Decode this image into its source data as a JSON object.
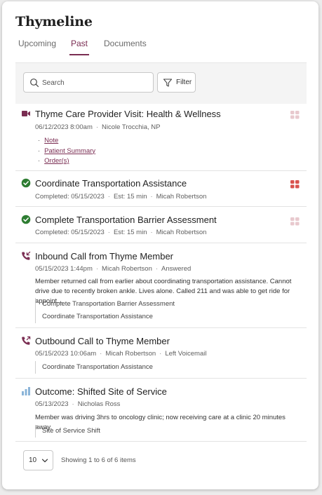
{
  "app": {
    "logo": "Thymeline"
  },
  "tabs": [
    {
      "label": "Upcoming",
      "active": false
    },
    {
      "label": "Past",
      "active": true
    },
    {
      "label": "Documents",
      "active": false
    }
  ],
  "toolbar": {
    "search_placeholder": "Search",
    "filter_label": "Filter"
  },
  "colors": {
    "accent": "#7a2d52",
    "success": "#2e7d32",
    "corner_active": "#d9534f",
    "corner_inactive": "#e8c9ce",
    "chart_icon": "#8ab4d8"
  },
  "items": [
    {
      "icon": "video-icon",
      "title": "Thyme Care Provider Visit: Health & Wellness",
      "date": "06/12/2023 8:00am",
      "person": "Nicole Trocchia, NP",
      "links": [
        "Note",
        "Patient Summary",
        "Order(s)"
      ]
    },
    {
      "icon": "check-circle-icon",
      "title": "Coordinate Transportation Assistance",
      "status": "Completed: 05/15/2023",
      "estimate": "Est: 15 min",
      "person": "Micah Robertson"
    },
    {
      "icon": "check-circle-icon",
      "title": "Complete Transportation Barrier Assessment",
      "status": "Completed: 05/15/2023",
      "estimate": "Est: 15 min",
      "person": "Micah Robertson"
    },
    {
      "icon": "inbound-call-icon",
      "title": "Inbound Call from Thyme Member",
      "date": "05/15/2023 1:44pm",
      "person": "Micah Robertson",
      "outcome": "Answered",
      "description": "Member returned call from earlier about coordinating transportation assistance. Cannot drive due to recently broken ankle. Lives alone. Called 211 and was able to get ride for appoint...",
      "related": [
        "Complete Transportation Barrier Assessment",
        "Coordinate Transportation Assistance"
      ]
    },
    {
      "icon": "outbound-call-icon",
      "title": "Outbound Call to Thyme Member",
      "date": "05/15/2023 10:06am",
      "person": "Micah Robertson",
      "outcome": "Left Voicemail",
      "related": [
        "Coordinate Transportation Assistance"
      ]
    },
    {
      "icon": "bar-chart-icon",
      "title": "Outcome: Shifted Site of Service",
      "date": "05/13/2023",
      "person": "Nicholas Ross",
      "description": "Member was driving 3hrs to oncology clinic; now receiving care at a clinic 20 minutes away.",
      "related": [
        "Site of Service Shift"
      ]
    }
  ],
  "pagination": {
    "page_size": "10",
    "summary": "Showing 1 to 6 of 6 items"
  }
}
